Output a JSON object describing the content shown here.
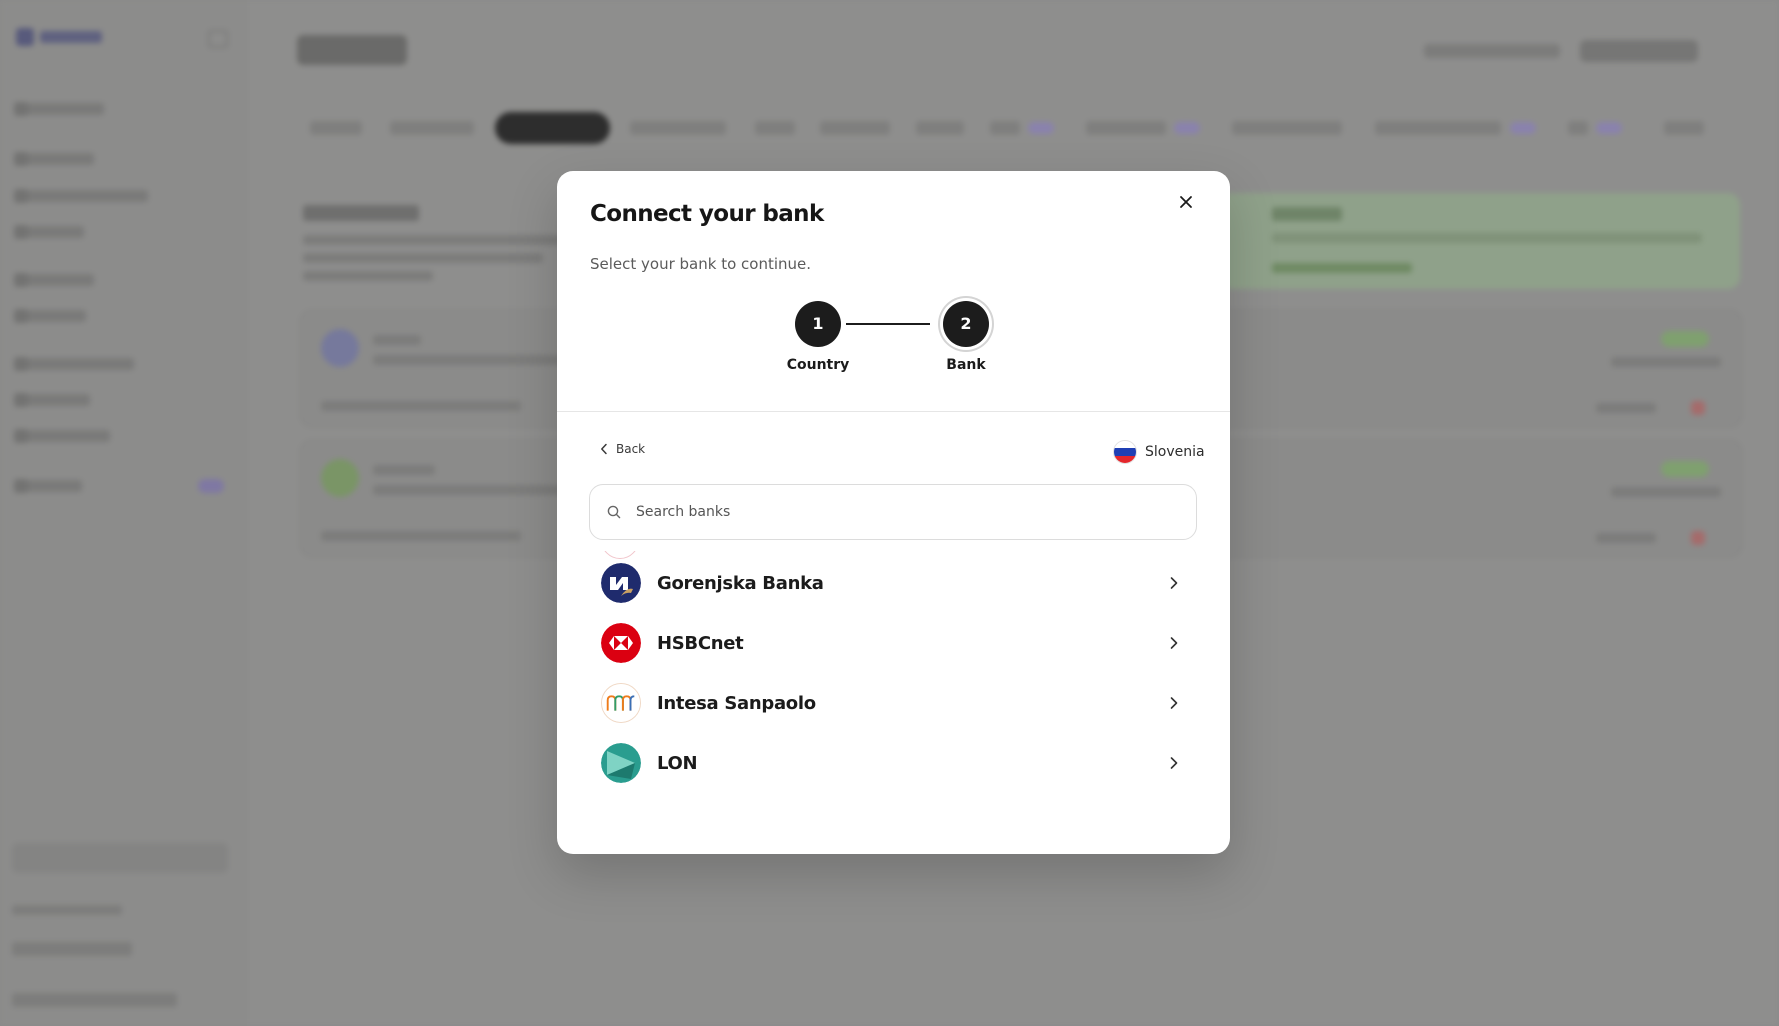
{
  "modal": {
    "title": "Connect your bank",
    "subtitle": "Select your bank to continue.",
    "steps": [
      {
        "number": "1",
        "label": "Country"
      },
      {
        "number": "2",
        "label": "Bank"
      }
    ],
    "back_label": "Back",
    "country": "Slovenia",
    "search": {
      "placeholder": "Search banks",
      "value": ""
    },
    "banks": [
      {
        "name": "Gorenjska Banka",
        "icon": "gorenjska-banka-logo"
      },
      {
        "name": "HSBCnet",
        "icon": "hsbc-logo"
      },
      {
        "name": "Intesa Sanpaolo",
        "icon": "intesa-sanpaolo-logo"
      },
      {
        "name": "LON",
        "icon": "lon-logo"
      }
    ]
  },
  "colors": {
    "overlay": "#8a8a89",
    "modal_bg": "#ffffff",
    "primary_dark": "#1c1c1c",
    "hsbc_red": "#db0011",
    "gorenjska_navy": "#1f2b6d",
    "intesa_orange": "#ef7b1a",
    "lon_teal": "#2a9d8f"
  }
}
